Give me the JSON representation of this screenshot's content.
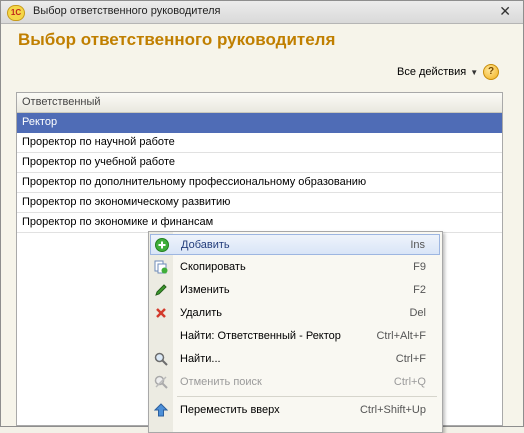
{
  "window": {
    "app_icon": "1C",
    "title": "Выбор ответственного руководителя",
    "close": "✕"
  },
  "form": {
    "title": "Выбор ответственного руководителя",
    "actions_label": "Все действия",
    "help_label": "?"
  },
  "table": {
    "header": "Ответственный",
    "rows": [
      "Ректор",
      "Проректор по научной работе",
      "Проректор по учебной работе",
      "Проректор по дополнительному профессиональному образованию",
      "Проректор по экономическому развитию",
      "Проректор по экономике и финансам"
    ]
  },
  "context_menu": {
    "items": [
      {
        "label": "Добавить",
        "shortcut": "Ins",
        "icon": "add-icon"
      },
      {
        "label": "Скопировать",
        "shortcut": "F9",
        "icon": "copy-icon"
      },
      {
        "label": "Изменить",
        "shortcut": "F2",
        "icon": "edit-icon"
      },
      {
        "label": "Удалить",
        "shortcut": "Del",
        "icon": "delete-icon"
      },
      {
        "label": "Найти: Ответственный - Ректор",
        "shortcut": "Ctrl+Alt+F",
        "icon": ""
      },
      {
        "label": "Найти...",
        "shortcut": "Ctrl+F",
        "icon": "search-icon"
      },
      {
        "label": "Отменить поиск",
        "shortcut": "Ctrl+Q",
        "icon": "cancel-search-icon"
      },
      {
        "label": "Переместить вверх",
        "shortcut": "Ctrl+Shift+Up",
        "icon": "move-up-icon"
      }
    ]
  },
  "colors": {
    "title_accent": "#c07f00",
    "selection": "#4f6cb6"
  }
}
